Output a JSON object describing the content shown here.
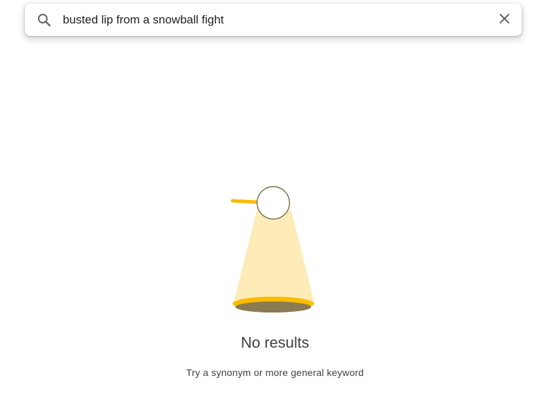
{
  "search": {
    "value": "busted lip from a snowball fight",
    "search_icon": "search-icon",
    "clear_icon": "close-icon"
  },
  "empty_state": {
    "illustration": "spotlight-illustration",
    "title": "No results",
    "subtitle": "Try a synonym or more general keyword"
  },
  "colors": {
    "beam": "#fdecb7",
    "ring": "#fbbc04",
    "floor": "#8a7b52",
    "lamp_outline": "#7a6a46",
    "icon": "#5f6368",
    "text": "#3c4043"
  }
}
